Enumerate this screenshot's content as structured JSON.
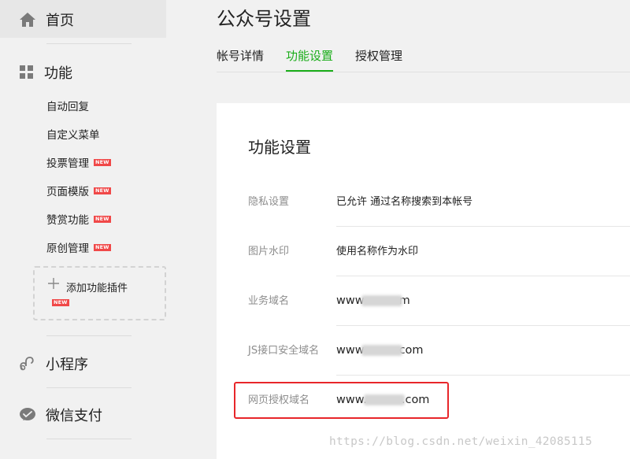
{
  "sidebar": {
    "home": {
      "label": "首页",
      "icon": "home-icon"
    },
    "features": {
      "label": "功能",
      "icon": "grid-icon",
      "items": [
        {
          "label": "自动回复",
          "new": false
        },
        {
          "label": "自定义菜单",
          "new": false
        },
        {
          "label": "投票管理",
          "new": true
        },
        {
          "label": "页面模版",
          "new": true
        },
        {
          "label": "赞赏功能",
          "new": true
        },
        {
          "label": "原创管理",
          "new": true
        }
      ],
      "add_plugin": {
        "label": "添加功能插件",
        "badge": "NEW"
      }
    },
    "miniprogram": {
      "label": "小程序",
      "icon": "mini-program-icon"
    },
    "wechat_pay": {
      "label": "微信支付",
      "icon": "wechat-pay-icon"
    },
    "new_badge": "NEW"
  },
  "main": {
    "title": "公众号设置",
    "tabs": [
      {
        "label": "帐号详情",
        "active": false
      },
      {
        "label": "功能设置",
        "active": true
      },
      {
        "label": "授权管理",
        "active": false
      }
    ],
    "panel": {
      "title": "功能设置",
      "rows": [
        {
          "label": "隐私设置",
          "value": "已允许 通过名称搜索到本帐号"
        },
        {
          "label": "图片水印",
          "value": "使用名称作为水印"
        },
        {
          "label": "业务域名",
          "value_prefix": "www",
          "value_suffix": "m"
        },
        {
          "label": "JS接口安全域名",
          "value_prefix": "www",
          "value_suffix": "com"
        },
        {
          "label": "网页授权域名",
          "value_prefix": "www.",
          "value_suffix": ".com"
        }
      ]
    }
  },
  "watermark": "https://blog.csdn.net/weixin_42085115",
  "colors": {
    "accent": "#1aad19",
    "highlight": "#e8262a",
    "new_badge": "#f04848"
  }
}
